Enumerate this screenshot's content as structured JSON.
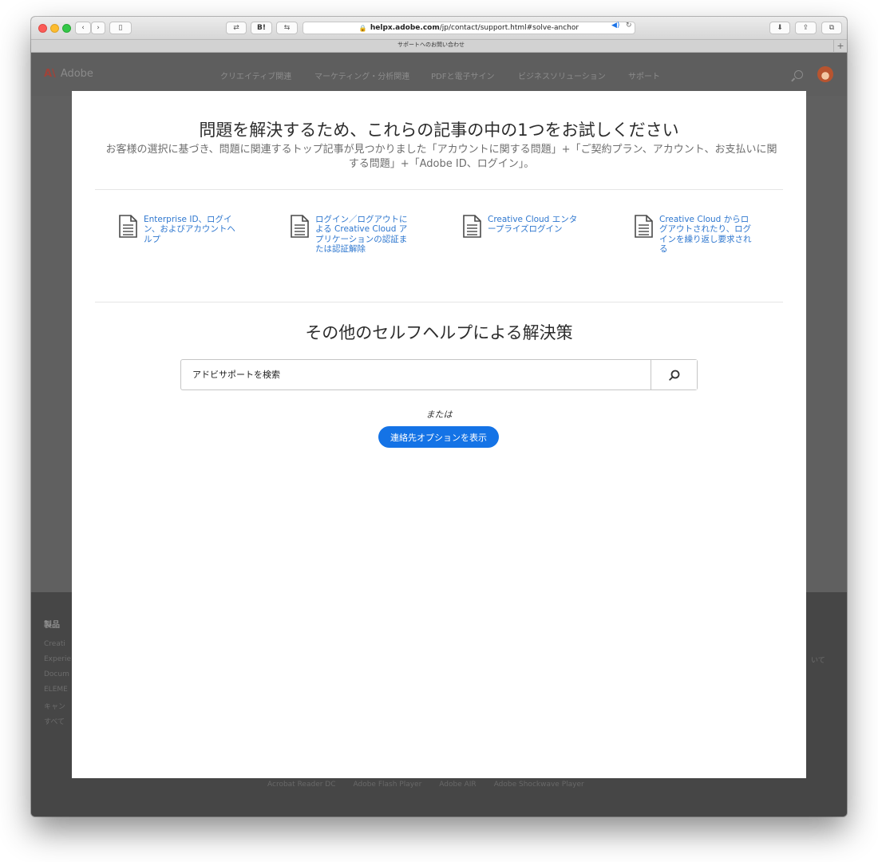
{
  "browser": {
    "url_host": "helpx.adobe.com",
    "url_path": "/jp/contact/support.html#solve-anchor",
    "tab_title": "サポートへのお問い合わせ",
    "toolbar_labels": {
      "bookmark_b": "B!"
    },
    "new_tab_label": "+"
  },
  "site": {
    "logo_mark": "A\\",
    "logo_text": "Adobe",
    "nav": [
      "クリエイティブ関連",
      "マーケティング・分析関連",
      "PDFと電子サイン",
      "ビジネスソリューション",
      "サポート"
    ],
    "footer": {
      "heading": "製品",
      "lines": [
        "Creati",
        "Experie",
        "Docum",
        "ELEME",
        "キャン",
        "すべて"
      ],
      "right_fragment": "いて",
      "links": [
        "Acrobat Reader DC",
        "Adobe Flash Player",
        "Adobe AIR",
        "Adobe Shockwave Player"
      ]
    }
  },
  "modal": {
    "title": "問題を解決するため、これらの記事の中の1つをお試しください",
    "subtitle": "お客様の選択に基づき、問題に関連するトップ記事が見つかりました「アカウントに関する問題」+「ご契約プラン、アカウント、お支払いに関する問題」+「Adobe ID、ログイン」。",
    "articles": [
      "Enterprise ID、ログイン、およびアカウントヘルプ",
      "ログイン／ログアウトによる Creative Cloud アプリケーションの認証または認証解除",
      "Creative Cloud エンタープライズログイン",
      "Creative Cloud からログアウトされたり、ログインを繰り返し要求される"
    ],
    "section_title": "その他のセルフヘルプによる解決策",
    "search_placeholder": "アドビサポートを検索",
    "or_text": "または",
    "contact_button": "連絡先オプションを表示"
  },
  "colors": {
    "accent": "#1473e6",
    "link": "#2e77cf",
    "overlay": "#5e5e5e"
  },
  "icons": {
    "article": "document-icon",
    "search": "search-icon"
  }
}
